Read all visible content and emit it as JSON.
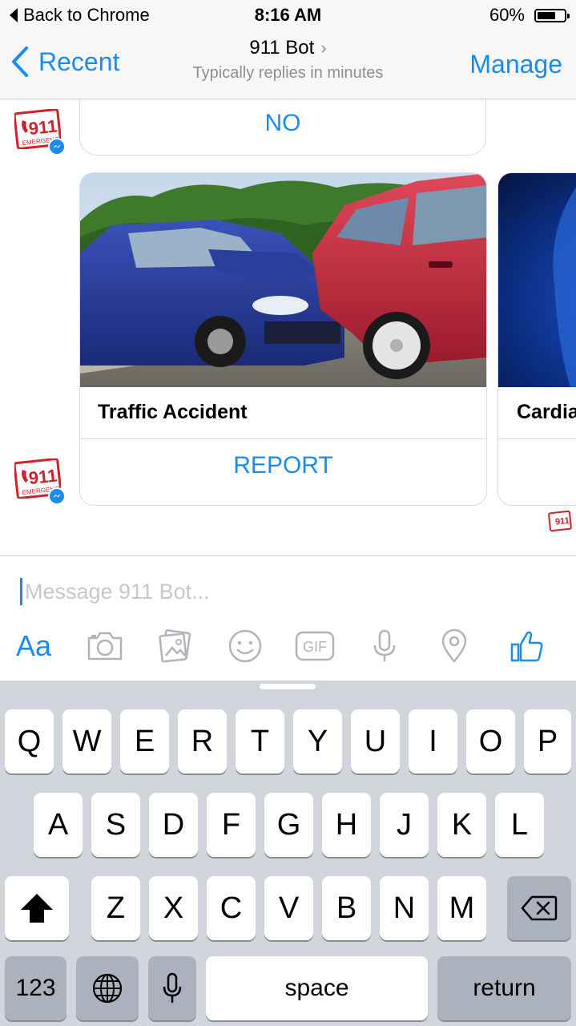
{
  "status_bar": {
    "back_label": "Back to Chrome",
    "time": "8:16 AM",
    "battery_pct": "60%",
    "battery_level": 0.6
  },
  "nav": {
    "back_label": "Recent",
    "title": "911 Bot",
    "subtitle": "Typically replies in minutes",
    "manage_label": "Manage"
  },
  "chat": {
    "no_button": "NO",
    "cards": [
      {
        "title": "Traffic Accident",
        "button": "REPORT"
      },
      {
        "title": "Cardia"
      }
    ]
  },
  "composer": {
    "placeholder": "Message 911 Bot...",
    "aa_label": "Aa",
    "gif_label": "GIF",
    "tools": [
      "camera-icon",
      "gallery-icon",
      "emoji-icon",
      "gif-icon",
      "microphone-icon",
      "location-icon",
      "like-icon"
    ]
  },
  "keyboard": {
    "row1": [
      "Q",
      "W",
      "E",
      "R",
      "T",
      "Y",
      "U",
      "I",
      "O",
      "P"
    ],
    "row2": [
      "A",
      "S",
      "D",
      "F",
      "G",
      "H",
      "J",
      "K",
      "L"
    ],
    "row3": [
      "Z",
      "X",
      "C",
      "V",
      "B",
      "N",
      "M"
    ],
    "numbers_label": "123",
    "space_label": "space",
    "return_label": "return"
  },
  "colors": {
    "accent": "#1a8cf0",
    "brand_red": "#d0202a",
    "keyboard_bg": "#d2d5db"
  }
}
